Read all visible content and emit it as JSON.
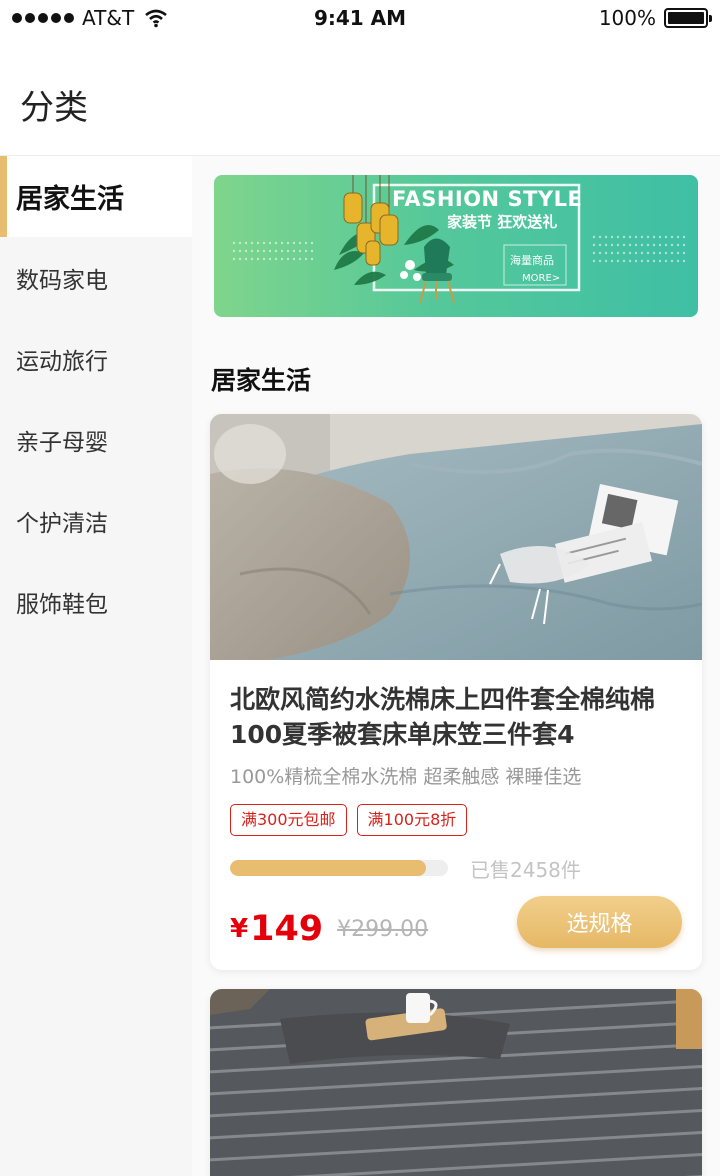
{
  "status_bar": {
    "carrier": "AT&T",
    "time": "9:41 AM",
    "battery": "100%"
  },
  "header": {
    "title": "分类"
  },
  "sidebar": {
    "items": [
      {
        "label": "居家生活",
        "active": true
      },
      {
        "label": "数码家电",
        "active": false
      },
      {
        "label": "运动旅行",
        "active": false
      },
      {
        "label": "亲子母婴",
        "active": false
      },
      {
        "label": "个护清洁",
        "active": false
      },
      {
        "label": "服饰鞋包",
        "active": false
      }
    ]
  },
  "banner": {
    "headline": "FASHION STYLE",
    "subline": "家装节 狂欢送礼",
    "tag": "海量商品",
    "more": "MORE>"
  },
  "section": {
    "title": "居家生活"
  },
  "products": [
    {
      "title": "北欧风简约水洗棉床上四件套全棉纯棉100夏季被套床单床笠三件套4",
      "desc": "100%精梳全棉水洗棉 超柔触感 裸睡佳选",
      "tags": [
        "满300元包邮",
        "满100元8折"
      ],
      "sold_fraction": 0.9,
      "sold_text": "已售2458件",
      "currency": "¥",
      "price": "149",
      "original_price": "¥299.00",
      "button_label": "选规格"
    }
  ],
  "colors": {
    "accent": "#e9bd70",
    "price_red": "#e3000b",
    "tag_red": "#d9211a"
  }
}
